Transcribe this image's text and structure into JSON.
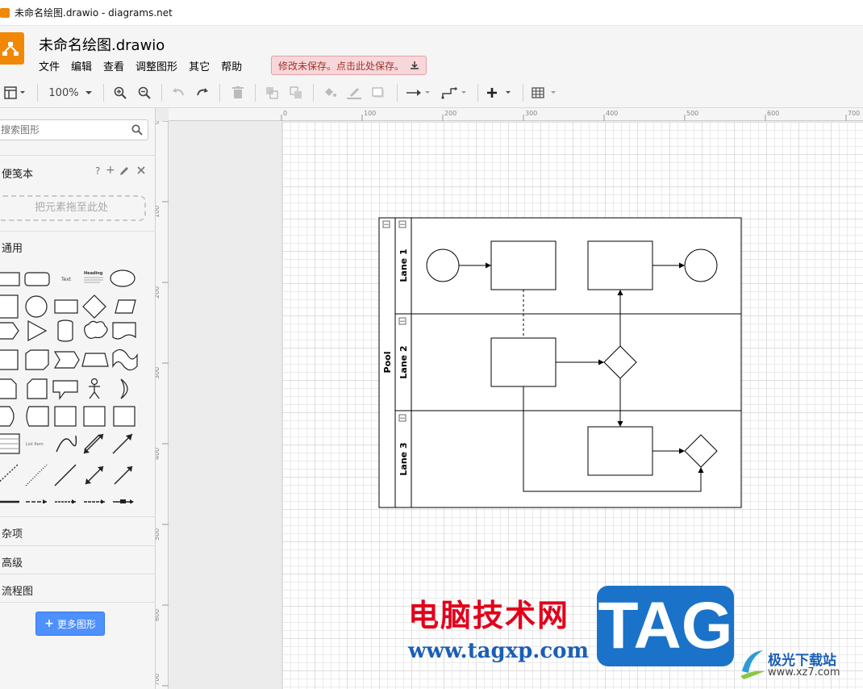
{
  "window": {
    "title": "未命名绘图.drawio - diagrams.net"
  },
  "header": {
    "doc_name": "未命名绘图.drawio",
    "menu": [
      "文件",
      "编辑",
      "查看",
      "调整图形",
      "其它",
      "帮助"
    ],
    "unsaved_notice": "修改未保存。点击此处保存。"
  },
  "toolbar": {
    "zoom": "100%"
  },
  "sidebar": {
    "search_placeholder": "搜索图形",
    "scratchpad_label": "便笺本",
    "scratchpad_help": "?",
    "scratchpad_add": "+",
    "drop_hint": "把元素拖至此处",
    "general_label": "通用",
    "shape_text": "Text",
    "shape_heading": "Heading",
    "shape_listitem": "List Item",
    "misc_label": "杂项",
    "advanced_label": "高级",
    "flowchart_label": "流程图",
    "more_shapes": "更多图形",
    "more_shapes_plus": "+"
  },
  "ruler": {
    "top_ticks": [
      "0",
      "100",
      "200",
      "300",
      "400",
      "500",
      "600",
      "700"
    ],
    "left_ticks": [
      "0",
      "100",
      "200",
      "300",
      "400",
      "500",
      "600",
      "700"
    ]
  },
  "diagram": {
    "pool_label": "Pool",
    "lanes": [
      "Lane 1",
      "Lane 2",
      "Lane 3"
    ],
    "collapse_glyph": "−"
  },
  "watermark": {
    "cn": "电脑技术网",
    "url": "www.tagxp.com",
    "tag": "TAG",
    "site_cn": "极光下载站",
    "site_url": "www.xz7.com"
  },
  "colors": {
    "brand": "#f08705",
    "unsaved_bg": "#f8d7da",
    "button": "#4d90fe"
  }
}
